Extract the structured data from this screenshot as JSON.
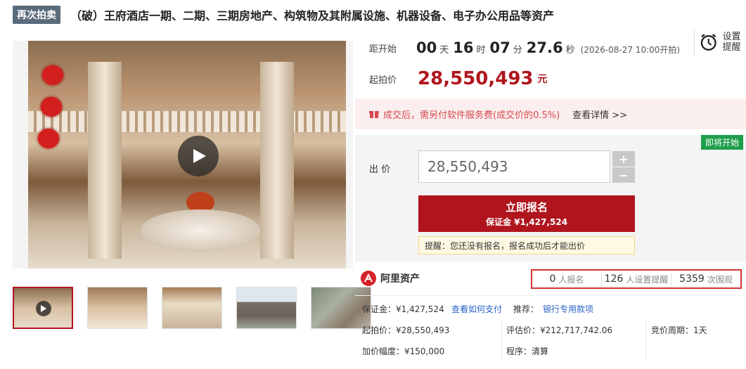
{
  "header": {
    "badge": "再次拍卖",
    "title": "（破）王府酒店一期、二期、三期房地产、构筑物及其附属设施、机器设备、电子办公用品等资产"
  },
  "countdown": {
    "label": "距开始",
    "days": "00",
    "days_unit": "天",
    "hours": "16",
    "hours_unit": "时",
    "minutes": "07",
    "minutes_unit": "分",
    "seconds": "27.6",
    "seconds_unit": "秒",
    "start_time": "(2026-08-27 10:00开拍)"
  },
  "reminder": {
    "label": "设置提醒",
    "icon": "alarm-clock-icon"
  },
  "starting_price": {
    "label": "起拍价",
    "value": "28,550,493",
    "unit": "元"
  },
  "notice": {
    "text": "成交后，需另付软件服务费(成交价的0.5%)",
    "link": "查看详情 >>"
  },
  "bid": {
    "status_badge": "即将开始",
    "label": "出 价",
    "value": "28,550,493",
    "plus": "+",
    "minus": "−",
    "signup_label": "立即报名",
    "deposit_line": "保证金 ¥1,427,524",
    "tip": "提醒：您还没有报名，报名成功后才能出价"
  },
  "brand": {
    "name": "阿里资产"
  },
  "stats": [
    {
      "value": "0",
      "label": "人报名"
    },
    {
      "value": "126",
      "label": "人设置提醒"
    },
    {
      "value": "5359",
      "label": "次围观"
    }
  ],
  "info": {
    "deposit": "保证金：¥1,427,524",
    "how_to_pay": "查看如何支付",
    "recommend_label": "推荐：",
    "recommend_link": "银行专用款项",
    "start_price": "起拍价：¥28,550,493",
    "assessed": "评估价：¥212,717,742.06",
    "cycle": "竞价周期：1天",
    "increment": "加价幅度：¥150,000",
    "procedure": "程序：清算"
  },
  "colors": {
    "accent": "#b0151d",
    "badge": "#5a6b7b",
    "soon": "#1e9e49",
    "link": "#2a62c7"
  }
}
